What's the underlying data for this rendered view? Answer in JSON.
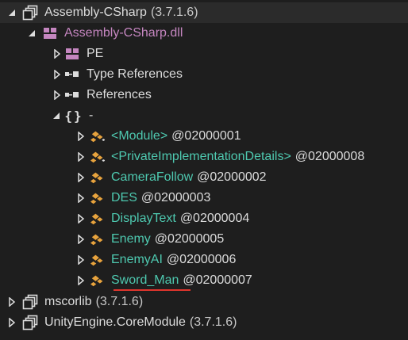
{
  "tree": {
    "root": {
      "name": "Assembly-CSharp",
      "version": "(3.7.1.6)"
    },
    "module": {
      "name": "Assembly-CSharp.dll"
    },
    "module_children": [
      {
        "label": "PE"
      },
      {
        "label": "Type References"
      },
      {
        "label": "References"
      }
    ],
    "namespace": {
      "label": "-"
    },
    "types": [
      {
        "name": "<Module>",
        "token": "@02000001"
      },
      {
        "name": "<PrivateImplementationDetails>",
        "token": "@02000008"
      },
      {
        "name": "CameraFollow",
        "token": "@02000002"
      },
      {
        "name": "DES",
        "token": "@02000003"
      },
      {
        "name": "DisplayText",
        "token": "@02000004"
      },
      {
        "name": "Enemy",
        "token": "@02000005"
      },
      {
        "name": "EnemyAI",
        "token": "@02000006"
      },
      {
        "name": "Sword_Man",
        "token": "@02000007"
      }
    ],
    "other_assemblies": [
      {
        "name": "mscorlib",
        "version": "(3.7.1.6)"
      },
      {
        "name": "UnityEngine.CoreModule",
        "version": "(3.7.1.6)"
      }
    ]
  },
  "colors": {
    "background": "#1e1e1e",
    "text": "#dcdcdc",
    "type_name": "#4ec9b0",
    "module_name": "#c586c0",
    "annotation_underline": "#e0352d"
  },
  "icons": {
    "expanded": "expanded-triangle-icon",
    "collapsed": "collapsed-triangle-icon",
    "assembly": "assembly-icon",
    "module": "module-icon",
    "references": "references-icon",
    "namespace": "namespace-braces-icon",
    "class": "class-icon"
  }
}
